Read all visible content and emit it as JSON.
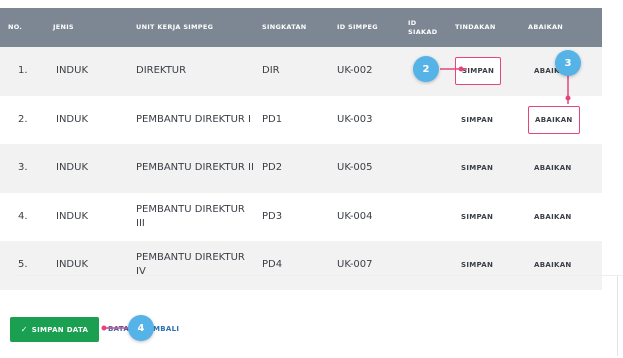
{
  "table": {
    "headers": [
      "NO.",
      "JENIS",
      "UNIT KERJA SIMPEG",
      "SINGKATAN",
      "ID SIMPEG",
      "ID\nSIAKAD",
      "TINDAKAN",
      "ABAIKAN"
    ],
    "rows": [
      {
        "no": "1.",
        "jenis": "INDUK",
        "unit": "DIREKTUR",
        "singkatan": "DIR",
        "id_simpeg": "UK-002",
        "id_siakad": "",
        "tindakan": "SIMPAN",
        "abaikan": "ABAIKAN"
      },
      {
        "no": "2.",
        "jenis": "INDUK",
        "unit": "PEMBANTU DIREKTUR I",
        "singkatan": "PD1",
        "id_simpeg": "UK-003",
        "id_siakad": "",
        "tindakan": "SIMPAN",
        "abaikan": "ABAIKAN"
      },
      {
        "no": "3.",
        "jenis": "INDUK",
        "unit": "PEMBANTU DIREKTUR II",
        "singkatan": "PD2",
        "id_simpeg": "UK-005",
        "id_siakad": "",
        "tindakan": "SIMPAN",
        "abaikan": "ABAIKAN"
      },
      {
        "no": "4.",
        "jenis": "INDUK",
        "unit": "PEMBANTU DIREKTUR III",
        "singkatan": "PD3",
        "id_simpeg": "UK-004",
        "id_siakad": "",
        "tindakan": "SIMPAN",
        "abaikan": "ABAIKAN"
      },
      {
        "no": "5.",
        "jenis": "INDUK",
        "unit": "PEMBANTU DIREKTUR IV",
        "singkatan": "PD4",
        "id_simpeg": "UK-007",
        "id_siakad": "",
        "tindakan": "SIMPAN",
        "abaikan": "ABAIKAN"
      }
    ]
  },
  "footer": {
    "save_label": "SIMPAN DATA",
    "check_icon": "✓",
    "cancel_label": "BATAL / KEMBALI"
  },
  "markers": [
    "2",
    "3",
    "4"
  ],
  "colors": {
    "header_bg": "#7c8793",
    "save_bg": "#1aa050",
    "highlight": "#e6457a",
    "marker": "#56b3e8",
    "link": "#2a6fb0"
  }
}
